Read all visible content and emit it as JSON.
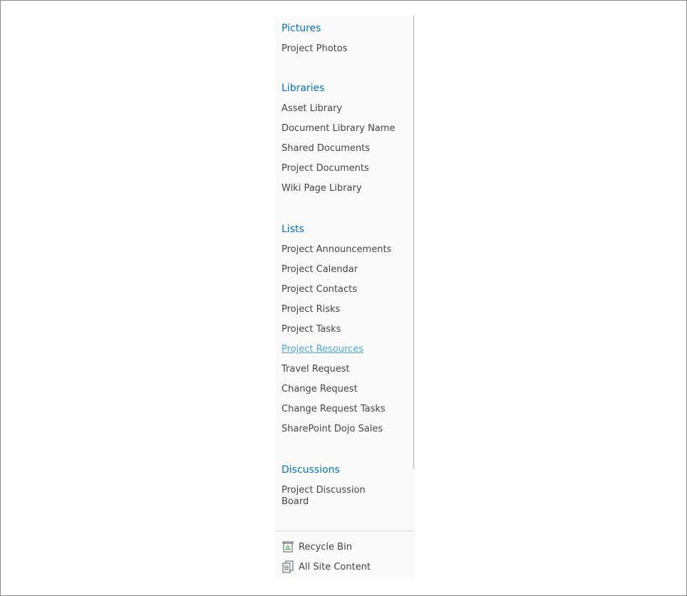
{
  "quick_launch": {
    "pictures": {
      "heading": "Pictures",
      "items": [
        "Project Photos"
      ]
    },
    "libraries": {
      "heading": "Libraries",
      "items": [
        "Asset Library",
        "Document Library Name",
        "Shared Documents",
        "Project Documents",
        "Wiki Page Library"
      ]
    },
    "lists": {
      "heading": "Lists",
      "items": [
        "Project Announcements",
        "Project Calendar",
        "Project Contacts",
        "Project Risks",
        "Project Tasks",
        "Project Resources",
        "Travel Request",
        "Change Request",
        "Change Request Tasks",
        "SharePoint Dojo Sales"
      ],
      "hovered_item": "Project Resources"
    },
    "discussions": {
      "heading": "Discussions",
      "items": [
        "Project Discussion Board"
      ]
    },
    "footer": {
      "recycle_bin": "Recycle Bin",
      "recycle_bin_icon": "recycle-bin-icon",
      "all_site_content": "All Site Content",
      "all_site_content_icon": "all-site-content-icon"
    }
  },
  "colors": {
    "heading": "#0072c6",
    "link": "#444444",
    "hover_link": "#4aa6e0",
    "panel_bg": "#fafafa"
  }
}
